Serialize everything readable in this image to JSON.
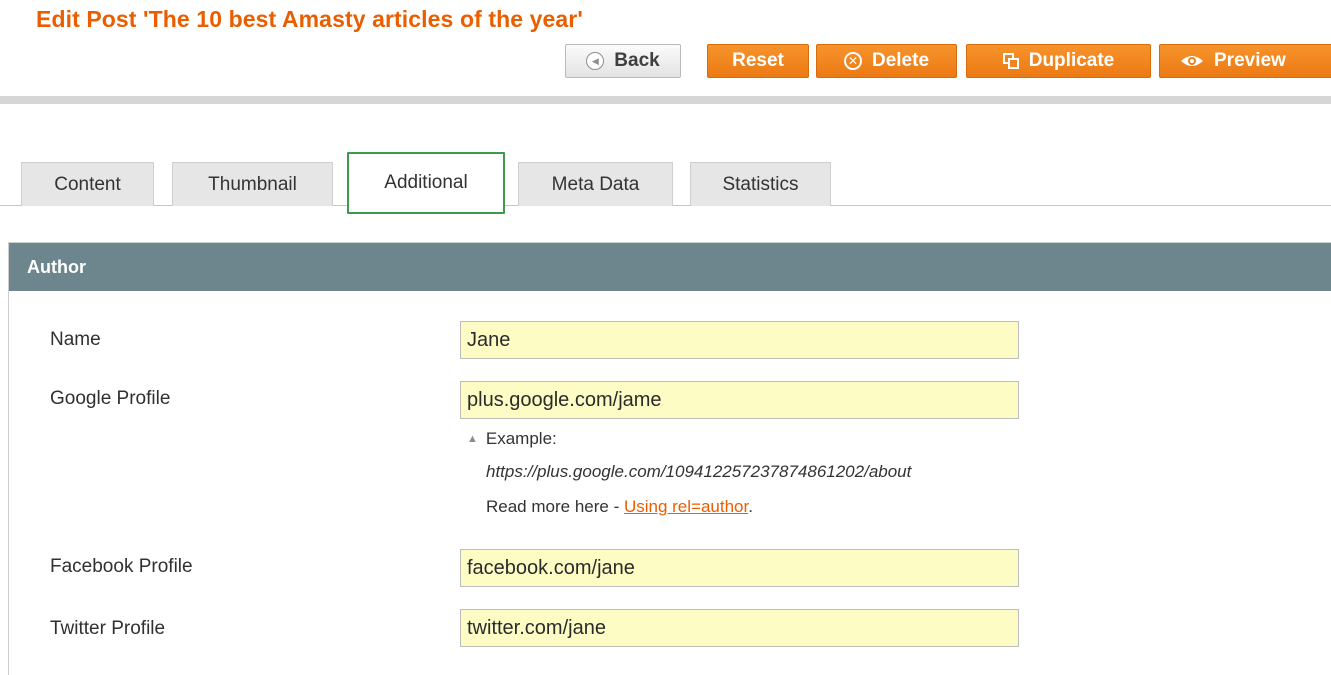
{
  "header": {
    "title": "Edit Post 'The 10 best Amasty articles of the year'"
  },
  "toolbar": {
    "back_label": "Back",
    "reset_label": "Reset",
    "delete_label": "Delete",
    "duplicate_label": "Duplicate",
    "preview_label": "Preview",
    "icons": {
      "back": "back-arrow-icon",
      "delete": "delete-x-icon",
      "duplicate": "duplicate-icon",
      "preview": "eye-icon"
    }
  },
  "tabs": [
    {
      "label": "Content",
      "active": false
    },
    {
      "label": "Thumbnail",
      "active": false
    },
    {
      "label": "Additional",
      "active": true
    },
    {
      "label": "Meta Data",
      "active": false
    },
    {
      "label": "Statistics",
      "active": false
    }
  ],
  "section": {
    "title": "Author",
    "fields": {
      "name": {
        "label": "Name",
        "value": "Jane"
      },
      "google": {
        "label": "Google Profile",
        "value": "plus.google.com/jame",
        "note_example": "Example:",
        "note_url": "https://plus.google.com/109412257237874861202/about",
        "note_read_more": "Read more here - ",
        "note_link": "Using rel=author",
        "note_end": "."
      },
      "facebook": {
        "label": "Facebook Profile",
        "value": "facebook.com/jane"
      },
      "twitter": {
        "label": "Twitter Profile",
        "value": "twitter.com/jane"
      }
    }
  },
  "colors": {
    "title": "#eb5e00",
    "button_orange": "#ef8420",
    "section_header": "#6d858c",
    "field_bg": "#fcfcc4",
    "active_tab_border": "#3d9a4c",
    "link": "#eb5e00"
  }
}
